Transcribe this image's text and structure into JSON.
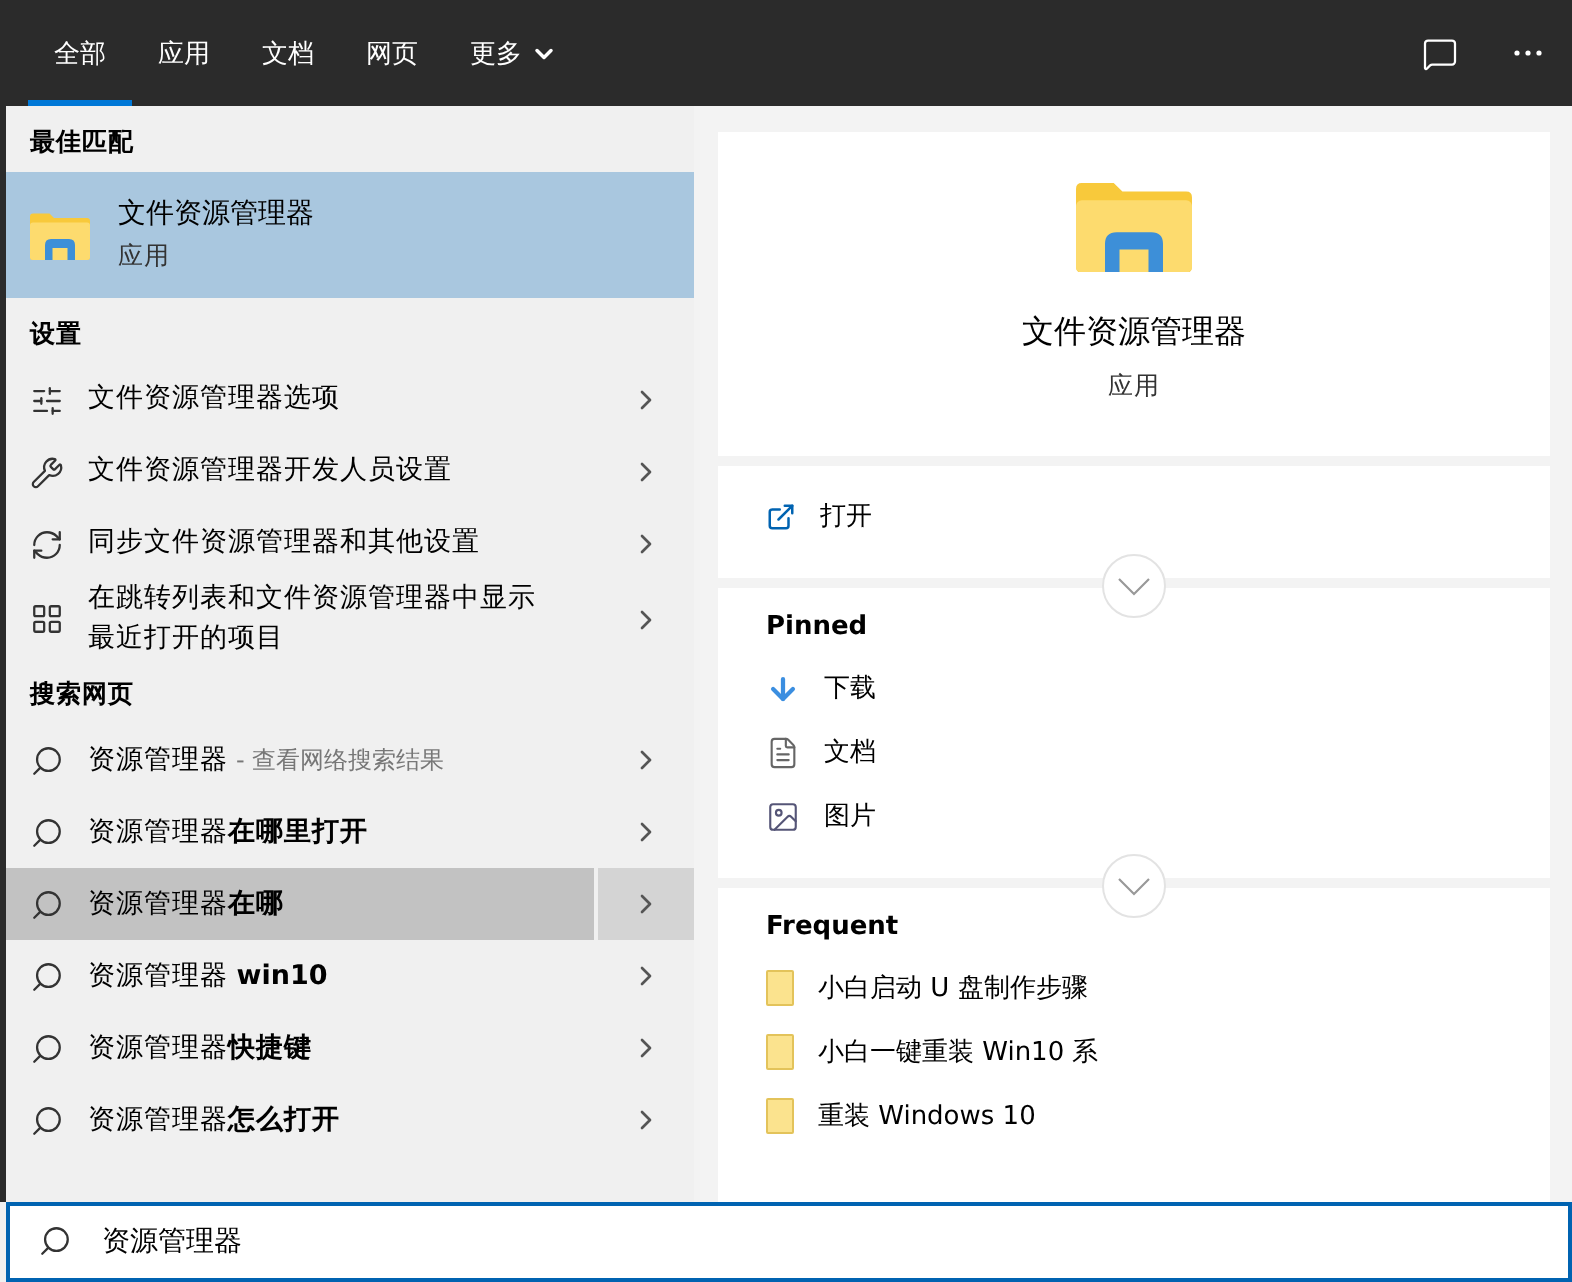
{
  "tabs": [
    {
      "label": "全部",
      "selected": true,
      "kind": "tab"
    },
    {
      "label": "应用",
      "selected": false,
      "kind": "tab"
    },
    {
      "label": "文档",
      "selected": false,
      "kind": "tab"
    },
    {
      "label": "网页",
      "selected": false,
      "kind": "tab"
    },
    {
      "label": "更多",
      "selected": false,
      "kind": "dropdown"
    }
  ],
  "best_match": {
    "header": "最佳匹配",
    "title": "文件资源管理器",
    "subtitle": "应用",
    "selected": true
  },
  "settings": {
    "header": "设置",
    "items": [
      {
        "label": "文件资源管理器选项",
        "kind": "options"
      },
      {
        "label": "文件资源管理器开发人员设置",
        "kind": "tools"
      },
      {
        "label": "同步文件资源管理器和其他设置",
        "kind": "sync"
      },
      {
        "label": "在跳转列表和文件资源管理器中显示最近打开的项目",
        "kind": "list"
      }
    ]
  },
  "web": {
    "header": "搜索网页",
    "items": [
      {
        "text": "资源管理器",
        "hint": "- 查看网络搜索结果",
        "selected": false
      },
      {
        "text": "资源管理器**在哪里打开**",
        "selected": false
      },
      {
        "text": "资源管理器**在哪**",
        "selected": true
      },
      {
        "text": "资源管理器 **win10**",
        "selected": false
      },
      {
        "text": "资源管理器**快捷键**",
        "selected": false
      },
      {
        "text": "资源管理器**怎么打开**",
        "selected": false
      }
    ]
  },
  "detail": {
    "title": "文件资源管理器",
    "subtitle": "应用",
    "actions": [
      {
        "label": "打开"
      }
    ],
    "pinned": {
      "header": "Pinned",
      "items": [
        {
          "label": "下载",
          "kind": "download"
        },
        {
          "label": "文档",
          "kind": "document"
        },
        {
          "label": "图片",
          "kind": "picture"
        }
      ]
    },
    "frequent": {
      "header": "Frequent",
      "items": [
        {
          "label": "小白启动 U 盘制作步骤"
        },
        {
          "label": "小白一键重装 Win10 系"
        },
        {
          "label": "重装 Windows 10"
        }
      ]
    }
  },
  "search": {
    "value": "资源管理器"
  }
}
